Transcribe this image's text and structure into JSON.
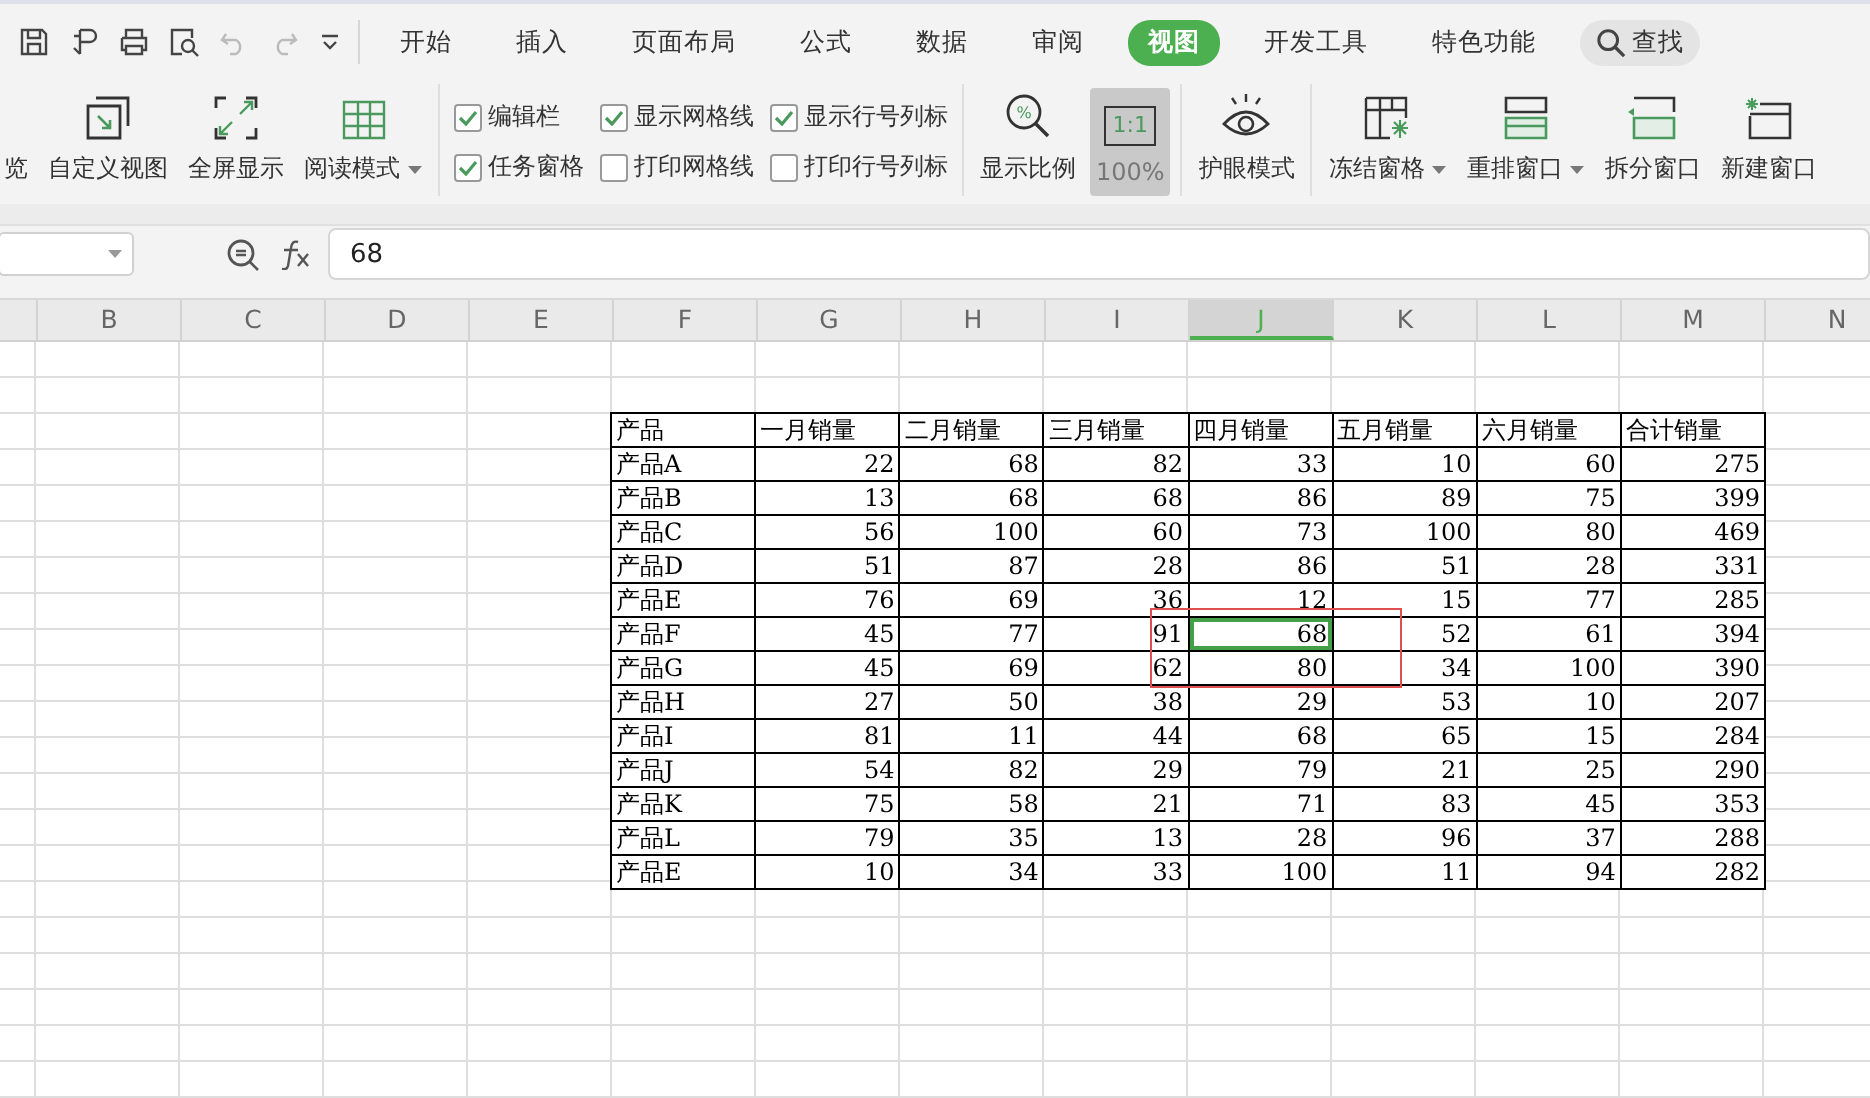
{
  "quick_access": {
    "undo_disabled": true,
    "redo_disabled": true
  },
  "menu_tabs": [
    {
      "label": "开始",
      "selected": false
    },
    {
      "label": "插入",
      "selected": false
    },
    {
      "label": "页面布局",
      "selected": false
    },
    {
      "label": "公式",
      "selected": false
    },
    {
      "label": "数据",
      "selected": false
    },
    {
      "label": "审阅",
      "selected": false
    },
    {
      "label": "视图",
      "selected": true
    },
    {
      "label": "开发工具",
      "selected": false
    },
    {
      "label": "特色功能",
      "selected": false
    }
  ],
  "search_button": {
    "label": "查找"
  },
  "ribbon_groups": [
    {
      "items": [
        {
          "kind": "button",
          "label": "览",
          "dropdown": false,
          "pressed": false
        },
        {
          "kind": "button",
          "label": "自定义视图",
          "dropdown": false,
          "pressed": false
        },
        {
          "kind": "button",
          "label": "全屏显示",
          "dropdown": false,
          "pressed": false
        },
        {
          "kind": "button",
          "label": "阅读模式",
          "dropdown": true,
          "pressed": false
        }
      ]
    },
    {
      "items": [
        {
          "kind": "checks",
          "checks": [
            {
              "label": "编辑栏",
              "checked": true
            },
            {
              "label": "任务窗格",
              "checked": true
            }
          ]
        },
        {
          "kind": "checks",
          "checks": [
            {
              "label": "显示网格线",
              "checked": true
            },
            {
              "label": "打印网格线",
              "checked": false
            }
          ]
        },
        {
          "kind": "checks",
          "checks": [
            {
              "label": "显示行号列标",
              "checked": true
            },
            {
              "label": "打印行号列标",
              "checked": false
            }
          ]
        }
      ]
    },
    {
      "items": [
        {
          "kind": "button",
          "label": "显示比例",
          "icon_text": "%",
          "dropdown": false,
          "pressed": false
        },
        {
          "kind": "button",
          "label": "100%",
          "icon_text": "1:1",
          "dropdown": false,
          "pressed": true
        }
      ]
    },
    {
      "items": [
        {
          "kind": "button",
          "label": "护眼模式",
          "dropdown": false,
          "pressed": false
        }
      ]
    },
    {
      "items": [
        {
          "kind": "button",
          "label": "冻结窗格",
          "dropdown": true,
          "pressed": false
        },
        {
          "kind": "button",
          "label": "重排窗口",
          "dropdown": true,
          "pressed": false
        },
        {
          "kind": "button",
          "label": "拆分窗口",
          "dropdown": false,
          "pressed": false
        },
        {
          "kind": "button",
          "label": "新建窗口",
          "dropdown": false,
          "pressed": false
        }
      ]
    }
  ],
  "formula_bar": {
    "value": "68"
  },
  "column_headers": [
    {
      "label": "B",
      "selected": false
    },
    {
      "label": "C",
      "selected": false
    },
    {
      "label": "D",
      "selected": false
    },
    {
      "label": "E",
      "selected": false
    },
    {
      "label": "F",
      "selected": false
    },
    {
      "label": "G",
      "selected": false
    },
    {
      "label": "H",
      "selected": false
    },
    {
      "label": "I",
      "selected": false
    },
    {
      "label": "J",
      "selected": true
    },
    {
      "label": "K",
      "selected": false
    },
    {
      "label": "L",
      "selected": false
    },
    {
      "label": "M",
      "selected": false
    },
    {
      "label": "N",
      "selected": false
    }
  ],
  "table": {
    "header": [
      "产品",
      "一月销量",
      "二月销量",
      "三月销量",
      "四月销量",
      "五月销量",
      "六月销量",
      "合计销量"
    ],
    "rows": [
      {
        "label": "产品A",
        "cells": [
          {
            "text": "22",
            "selected": false
          },
          {
            "text": "68",
            "selected": false
          },
          {
            "text": "82",
            "selected": false
          },
          {
            "text": "33",
            "selected": false
          },
          {
            "text": "10",
            "selected": false
          },
          {
            "text": "60",
            "selected": false
          },
          {
            "text": "275",
            "selected": false
          }
        ]
      },
      {
        "label": "产品B",
        "cells": [
          {
            "text": "13",
            "selected": false
          },
          {
            "text": "68",
            "selected": false
          },
          {
            "text": "68",
            "selected": false
          },
          {
            "text": "86",
            "selected": false
          },
          {
            "text": "89",
            "selected": false
          },
          {
            "text": "75",
            "selected": false
          },
          {
            "text": "399",
            "selected": false
          }
        ]
      },
      {
        "label": "产品C",
        "cells": [
          {
            "text": "56",
            "selected": false
          },
          {
            "text": "100",
            "selected": false
          },
          {
            "text": "60",
            "selected": false
          },
          {
            "text": "73",
            "selected": false
          },
          {
            "text": "100",
            "selected": false
          },
          {
            "text": "80",
            "selected": false
          },
          {
            "text": "469",
            "selected": false
          }
        ]
      },
      {
        "label": "产品D",
        "cells": [
          {
            "text": "51",
            "selected": false
          },
          {
            "text": "87",
            "selected": false
          },
          {
            "text": "28",
            "selected": false
          },
          {
            "text": "86",
            "selected": false
          },
          {
            "text": "51",
            "selected": false
          },
          {
            "text": "28",
            "selected": false
          },
          {
            "text": "331",
            "selected": false
          }
        ]
      },
      {
        "label": "产品E",
        "cells": [
          {
            "text": "76",
            "selected": false
          },
          {
            "text": "69",
            "selected": false
          },
          {
            "text": "36",
            "selected": false
          },
          {
            "text": "12",
            "selected": false
          },
          {
            "text": "15",
            "selected": false
          },
          {
            "text": "77",
            "selected": false
          },
          {
            "text": "285",
            "selected": false
          }
        ]
      },
      {
        "label": "产品F",
        "cells": [
          {
            "text": "45",
            "selected": false
          },
          {
            "text": "77",
            "selected": false
          },
          {
            "text": "91",
            "selected": false
          },
          {
            "text": "68",
            "selected": true
          },
          {
            "text": "52",
            "selected": false
          },
          {
            "text": "61",
            "selected": false
          },
          {
            "text": "394",
            "selected": false
          }
        ]
      },
      {
        "label": "产品G",
        "cells": [
          {
            "text": "45",
            "selected": false
          },
          {
            "text": "69",
            "selected": false
          },
          {
            "text": "62",
            "selected": false
          },
          {
            "text": "80",
            "selected": false
          },
          {
            "text": "34",
            "selected": false
          },
          {
            "text": "100",
            "selected": false
          },
          {
            "text": "390",
            "selected": false
          }
        ]
      },
      {
        "label": "产品H",
        "cells": [
          {
            "text": "27",
            "selected": false
          },
          {
            "text": "50",
            "selected": false
          },
          {
            "text": "38",
            "selected": false
          },
          {
            "text": "29",
            "selected": false
          },
          {
            "text": "53",
            "selected": false
          },
          {
            "text": "10",
            "selected": false
          },
          {
            "text": "207",
            "selected": false
          }
        ]
      },
      {
        "label": "产品I",
        "cells": [
          {
            "text": "81",
            "selected": false
          },
          {
            "text": "11",
            "selected": false
          },
          {
            "text": "44",
            "selected": false
          },
          {
            "text": "68",
            "selected": false
          },
          {
            "text": "65",
            "selected": false
          },
          {
            "text": "15",
            "selected": false
          },
          {
            "text": "284",
            "selected": false
          }
        ]
      },
      {
        "label": "产品J",
        "cells": [
          {
            "text": "54",
            "selected": false
          },
          {
            "text": "82",
            "selected": false
          },
          {
            "text": "29",
            "selected": false
          },
          {
            "text": "79",
            "selected": false
          },
          {
            "text": "21",
            "selected": false
          },
          {
            "text": "25",
            "selected": false
          },
          {
            "text": "290",
            "selected": false
          }
        ]
      },
      {
        "label": "产品K",
        "cells": [
          {
            "text": "75",
            "selected": false
          },
          {
            "text": "58",
            "selected": false
          },
          {
            "text": "21",
            "selected": false
          },
          {
            "text": "71",
            "selected": false
          },
          {
            "text": "83",
            "selected": false
          },
          {
            "text": "45",
            "selected": false
          },
          {
            "text": "353",
            "selected": false
          }
        ]
      },
      {
        "label": "产品L",
        "cells": [
          {
            "text": "79",
            "selected": false
          },
          {
            "text": "35",
            "selected": false
          },
          {
            "text": "13",
            "selected": false
          },
          {
            "text": "28",
            "selected": false
          },
          {
            "text": "96",
            "selected": false
          },
          {
            "text": "37",
            "selected": false
          },
          {
            "text": "288",
            "selected": false
          }
        ]
      },
      {
        "label": "产品E",
        "cells": [
          {
            "text": "10",
            "selected": false
          },
          {
            "text": "34",
            "selected": false
          },
          {
            "text": "33",
            "selected": false
          },
          {
            "text": "100",
            "selected": false
          },
          {
            "text": "11",
            "selected": false
          },
          {
            "text": "94",
            "selected": false
          },
          {
            "text": "282",
            "selected": false
          }
        ]
      }
    ]
  }
}
